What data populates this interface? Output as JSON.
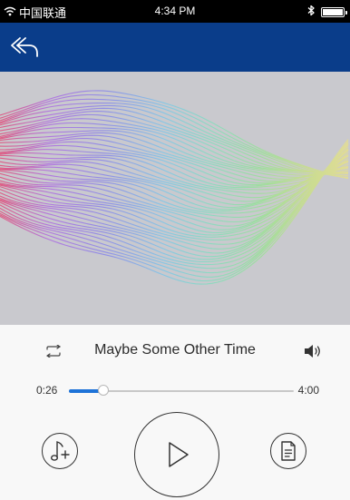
{
  "status_bar": {
    "carrier": "中国联通",
    "time": "4:34 PM",
    "icons": {
      "wifi": "wifi-icon",
      "bluetooth": "bluetooth-icon",
      "battery": "battery-icon"
    }
  },
  "nav": {
    "back_icon": "back-arrow-icon"
  },
  "artwork": {
    "colors": [
      "#e0507a",
      "#b06ee0",
      "#8a88e8",
      "#7ec6e8",
      "#84dcc0",
      "#98e09a",
      "#c8dc90",
      "#e2dc96"
    ],
    "background": "#c9c9ce"
  },
  "player": {
    "title": "Maybe Some Other Time",
    "elapsed": "0:26",
    "total": "4:00",
    "progress": 0.155,
    "accent_color": "#1e73d8",
    "icons": {
      "repeat": "repeat-icon",
      "volume": "speaker-icon",
      "add": "music-note-add-icon",
      "play": "play-icon",
      "lyrics": "document-icon"
    }
  },
  "theme": {
    "nav_color": "#0a3d8a",
    "status_bar_color": "#000000"
  }
}
